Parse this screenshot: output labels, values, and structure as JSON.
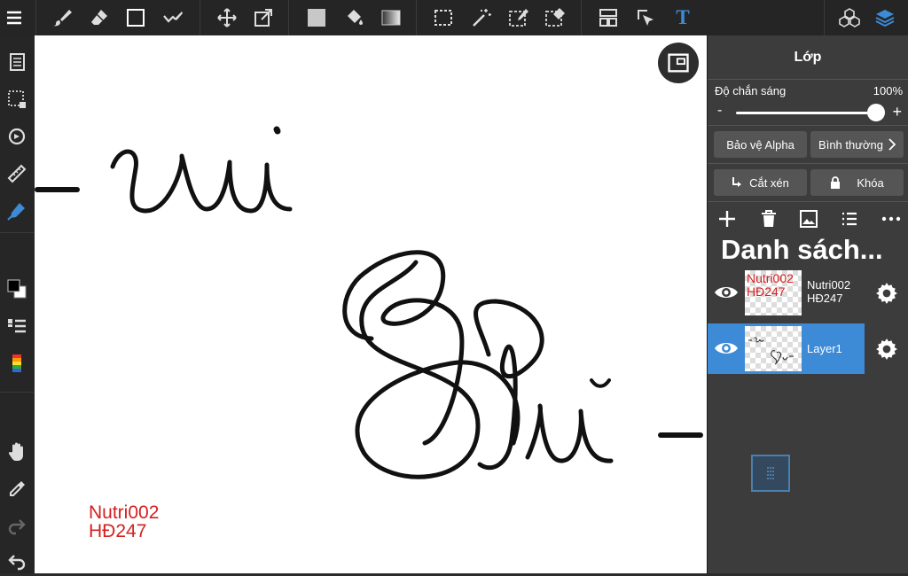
{
  "panel": {
    "title": "Lớp",
    "opacity_label": "Độ chắn sáng",
    "opacity_value": "100%",
    "opacity_level": 1.0,
    "slider_minus": "-",
    "slider_plus": "+",
    "alpha_protect_label": "Bảo vệ Alpha",
    "blend_mode_label": "Bình thường",
    "clipping_label": "Cắt xén",
    "lock_label": "Khóa",
    "layer_list_title": "Danh sách..."
  },
  "layers": [
    {
      "name": "Nutri002 HĐ247",
      "thumb_text_1": "Nutri002",
      "thumb_text_2": "HĐ247",
      "selected": false
    },
    {
      "name": "Layer1",
      "selected": true
    }
  ],
  "canvas": {
    "watermark_line1": "Nutri002",
    "watermark_line2": "HĐ247"
  },
  "toolbar": {
    "text_tool_glyph": "T"
  },
  "colors": {
    "accent": "#3d8ad6",
    "watermark": "#d42020",
    "panel_bg": "#3c3c3c",
    "toolbar_bg": "#252525"
  },
  "icons": [
    "menu-icon",
    "brush-icon",
    "eraser-icon",
    "rectangle-icon",
    "brush-settings-icon",
    "move-icon",
    "transform-icon",
    "fill-color-icon",
    "bucket-icon",
    "gradient-icon",
    "select-rect-icon",
    "magic-wand-icon",
    "select-pen-icon",
    "select-eraser-icon",
    "layout-icon",
    "select-layer-icon",
    "text-tool-icon",
    "materials-icon",
    "layers-icon",
    "pages-icon",
    "select-dotted-icon",
    "rotate-icon",
    "ruler-icon",
    "pen-icon",
    "color-swatch-icon",
    "layer-list-icon",
    "color-palette-icon",
    "hand-icon",
    "eyedropper-icon",
    "redo-icon",
    "undo-icon"
  ]
}
